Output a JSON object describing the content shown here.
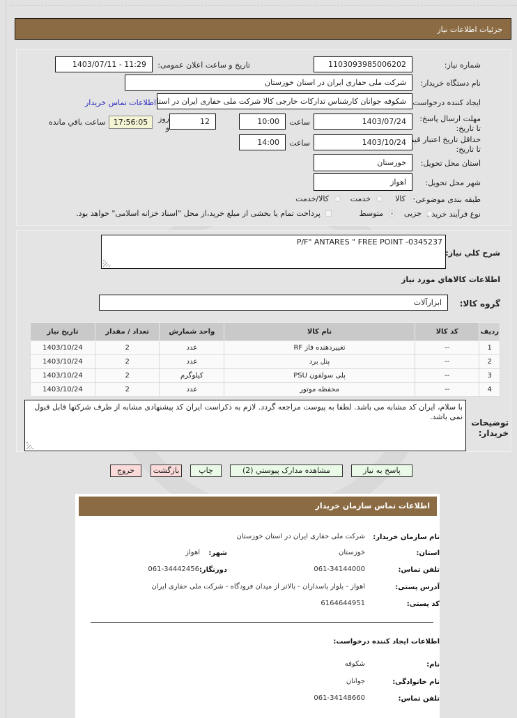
{
  "page": {
    "title": "جزئیات اطلاعات نیاز"
  },
  "header_info": {
    "need_number_label": "شماره نیاز:",
    "need_number": "1103093985006202",
    "announce_label": "تاریخ و ساعت اعلان عمومی:",
    "announce_value": "1403/07/11 - 11:29",
    "buyer_org_label": "نام دستگاه خریدار:",
    "buyer_org": "شرکت ملی حفاری ایران در استان خوزستان",
    "creator_label": "ایجاد کننده درخواست:",
    "creator": "شکوفه جوانان کارشناس تدارکات خارجی کالا شرکت ملی حفاری ایران در استان خوزستان",
    "buyer_contact_link": "اطلاعات تماس خریدار",
    "deadline_label": "مهلت ارسال پاسخ: تا تاریخ:",
    "deadline_date": "1403/07/24",
    "time_label": "ساعت",
    "deadline_time": "10:00",
    "days_value": "12",
    "days_label": "روز و",
    "remaining_time": "17:56:05",
    "remaining_label": "ساعت باقي مانده",
    "price_validity_label": "حداقل تاریخ اعتبار قیمت: تا تاریخ:",
    "price_validity_date": "1403/10/24",
    "price_validity_time": "14:00",
    "province_label": "استان محل تحویل:",
    "province": "خوزستان",
    "city_label": "شهر محل تحویل:",
    "city": "اهواز",
    "category_label": "طبقه بندی موضوعی:",
    "category_options": [
      {
        "label": "کالا",
        "selected": true
      },
      {
        "label": "خدمت",
        "selected": false
      },
      {
        "label": "کالا/خدمت",
        "selected": false
      }
    ],
    "purchase_type_label": "نوع فرآیند خرید :",
    "purchase_type_options": [
      {
        "label": "جزیی",
        "selected": false
      },
      {
        "label": "متوسط",
        "selected": true
      }
    ],
    "treasury_checkbox_label": "پرداخت تمام یا بخشی از مبلغ خرید،از محل \"اسناد خزانه اسلامی\" خواهد بود.",
    "treasury_checked": false
  },
  "details": {
    "description_label": "شرح کلي نیاز:",
    "description": "P/F\" ANTARES \" FREE POINT -0345237",
    "goods_info_heading": "اطلاعات کالاهاي مورد نیاز",
    "goods_group_label": "گروه کالا:",
    "goods_group": "ابزارآلات",
    "table": {
      "columns": [
        "ردیف",
        "کد کالا",
        "نام کالا",
        "واحد شمارش",
        "تعداد / مقدار",
        "تاریخ نیاز"
      ],
      "rows": [
        [
          "1",
          "--",
          "تغییردهنده فاز RF",
          "عدد",
          "2",
          "1403/10/24"
        ],
        [
          "2",
          "--",
          "پنل برد",
          "عدد",
          "2",
          "1403/10/24"
        ],
        [
          "3",
          "--",
          "پلی سولفون PSU",
          "کیلوگرم",
          "2",
          "1403/10/24"
        ],
        [
          "4",
          "--",
          "محفظه موتور",
          "عدد",
          "2",
          "1403/10/24"
        ]
      ]
    },
    "buyer_notes_label": "توضیحات خریدار:",
    "buyer_notes": "با سلام، ایران کد مشابه می باشد. لطفا به پیوست مراجعه گردد. لازم به ذکراست ایران کد پیشنهادی مشابه از طرف شرکتها قابل قبول نمی باشد."
  },
  "buttons": {
    "reply": "پاسخ به نیاز",
    "attachments": "مشاهده مدارک پیوستي (2)",
    "print": "چاپ",
    "back": "بازگشت",
    "exit": "خروج"
  },
  "contact_card": {
    "title": "اطلاعات تماس سازمان خریدار",
    "org_name_label": "نام سازمان خریدار:",
    "org_name": "شرکت ملی حفاری ایران در استان خوزستان",
    "province_label": "استان:",
    "province": "خوزستان",
    "city_label": "شهر:",
    "city": "اهواز",
    "phone_label": "تلفن تماس:",
    "phone": "061-34144000",
    "fax_label": "دورنگار:",
    "fax": "061-34442456",
    "address_label": "آدرس پستی:",
    "address": "اهواز - بلوار پاسداران - بالاتر از میدان فرودگاه - شرکت ملی حفاری ایران",
    "postal_label": "کد پستی:",
    "postal": "6164644951",
    "creator_heading": "اطلاعات ایجاد کننده درخواست:",
    "creator_name_label": "نام:",
    "creator_name": "شکوفه",
    "creator_family_label": "نام خانوادگی:",
    "creator_family": "جوانان",
    "creator_phone_label": "تلفن تماس:",
    "creator_phone": "061-34148660"
  },
  "colors": {
    "header_brown": "#8b6b43",
    "page_bg": "#e2e2e2",
    "remaining_bg": "#f5f5d6",
    "green_button": "#e9fbe6",
    "red_button": "#fbdada",
    "link_blue": "#2a2ac0"
  }
}
